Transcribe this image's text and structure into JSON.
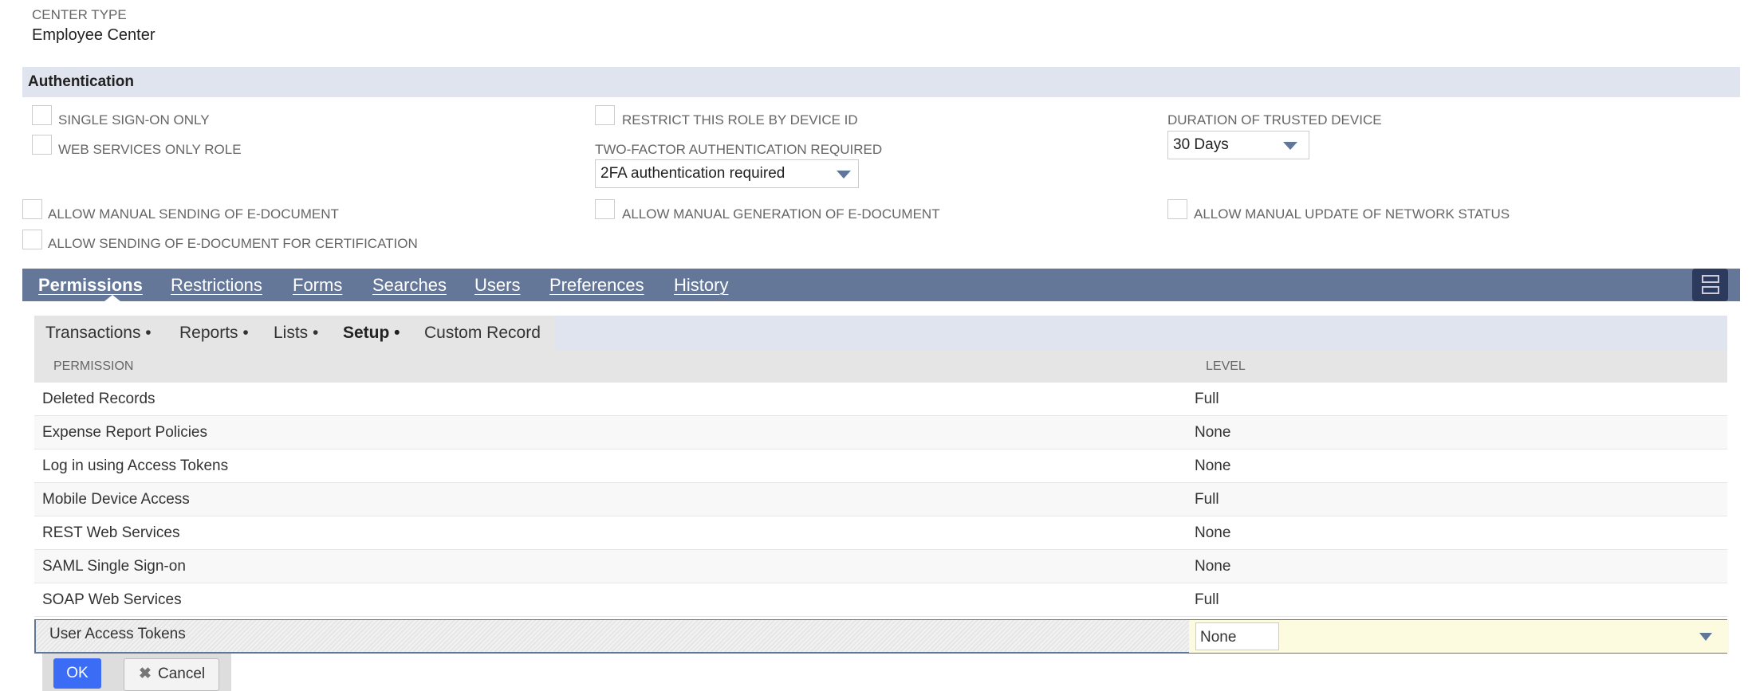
{
  "center_type": {
    "label": "CENTER TYPE",
    "value": "Employee Center"
  },
  "authentication": {
    "title": "Authentication",
    "single_sign_on_only": "SINGLE SIGN-ON ONLY",
    "web_services_only_role": "WEB SERVICES ONLY ROLE",
    "restrict_by_device_id": "RESTRICT THIS ROLE BY DEVICE ID",
    "two_factor_label": "TWO-FACTOR AUTHENTICATION REQUIRED",
    "two_factor_value": "2FA authentication required",
    "duration_label": "DURATION OF TRUSTED DEVICE",
    "duration_value": "30 Days",
    "allow_manual_sending": "ALLOW MANUAL SENDING OF E-DOCUMENT",
    "allow_manual_generation": "ALLOW MANUAL GENERATION OF E-DOCUMENT",
    "allow_manual_update": "ALLOW MANUAL UPDATE OF NETWORK STATUS",
    "allow_sending_certification": "ALLOW SENDING OF E-DOCUMENT FOR CERTIFICATION"
  },
  "tabs": [
    "Permissions",
    "Restrictions",
    "Forms",
    "Searches",
    "Users",
    "Preferences",
    "History"
  ],
  "subtabs": [
    "Transactions •",
    "Reports •",
    "Lists •",
    "Setup •",
    "Custom Record"
  ],
  "table": {
    "headers": [
      "PERMISSION",
      "LEVEL"
    ],
    "rows": [
      [
        "Deleted Records",
        "Full"
      ],
      [
        "Expense Report Policies",
        "None"
      ],
      [
        "Log in using Access Tokens",
        "None"
      ],
      [
        "Mobile Device Access",
        "Full"
      ],
      [
        "REST Web Services",
        "None"
      ],
      [
        "SAML Single Sign-on",
        "None"
      ],
      [
        "SOAP Web Services",
        "Full"
      ]
    ],
    "edit_row": {
      "permission": "User Access Tokens",
      "level": "None"
    }
  },
  "buttons": {
    "ok": "OK",
    "cancel": "Cancel"
  }
}
